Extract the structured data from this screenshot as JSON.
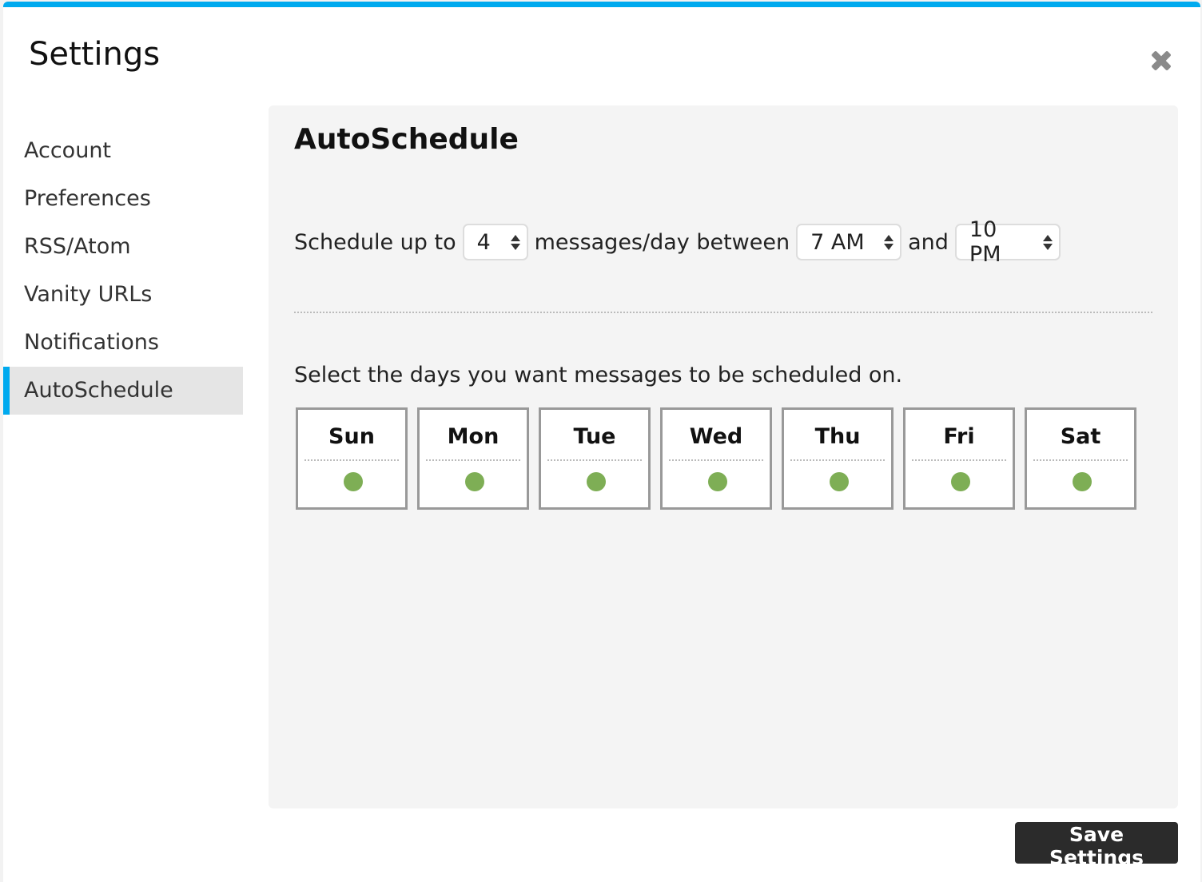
{
  "dialog": {
    "title": "Settings",
    "accent_color": "#00aaef",
    "close_icon": "close-x-icon"
  },
  "sidebar": {
    "items": [
      {
        "label": "Account",
        "active": false
      },
      {
        "label": "Preferences",
        "active": false
      },
      {
        "label": "RSS/Atom",
        "active": false
      },
      {
        "label": "Vanity URLs",
        "active": false
      },
      {
        "label": "Notifications",
        "active": false
      },
      {
        "label": "AutoSchedule",
        "active": true
      }
    ]
  },
  "panel": {
    "heading": "AutoSchedule",
    "schedule": {
      "prefix": "Schedule up to",
      "count_value": "4",
      "middle": "messages/day between",
      "start_value": "7 AM",
      "joiner": "and",
      "end_value": "10 PM"
    },
    "days_prompt": "Select the days you want messages to be scheduled on.",
    "days": [
      {
        "label": "Sun",
        "enabled": true
      },
      {
        "label": "Mon",
        "enabled": true
      },
      {
        "label": "Tue",
        "enabled": true
      },
      {
        "label": "Wed",
        "enabled": true
      },
      {
        "label": "Thu",
        "enabled": true
      },
      {
        "label": "Fri",
        "enabled": true
      },
      {
        "label": "Sat",
        "enabled": true
      }
    ],
    "enabled_color": "#7eae55"
  },
  "footer": {
    "save_label": "Save Settings"
  }
}
